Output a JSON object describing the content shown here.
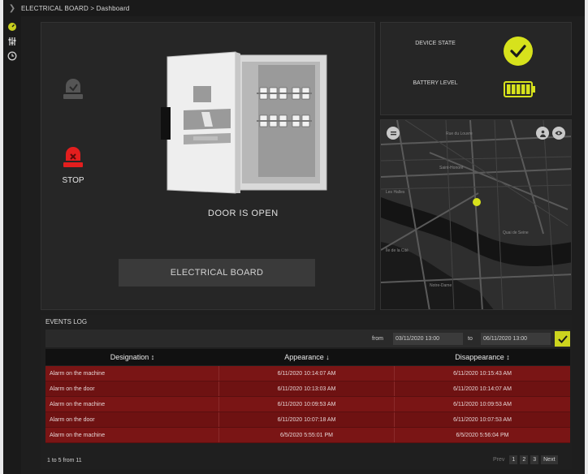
{
  "header": {
    "breadcrumb": "ELECTRICAL BOARD > Dashboard"
  },
  "sidebar": {
    "icons": [
      "gauge-icon",
      "sliders-icon",
      "clock-icon"
    ]
  },
  "main": {
    "stop_label": "STOP",
    "door_status": "DOOR IS OPEN",
    "board_button": "ELECTRICAL BOARD"
  },
  "device": {
    "state_label": "DEVICE STATE",
    "battery_label": "BATTERY LEVEL",
    "battery_level_fraction": 1.0
  },
  "map": {
    "labels": [
      "Rue du Louvre",
      "Saint-Honoré",
      "Les Halles",
      "Île de la Cité",
      "Quai de Seine",
      "Notre-Dame"
    ]
  },
  "events": {
    "title": "EVENTS LOG",
    "from_label": "from",
    "from_value": "03/11/2020 13:00",
    "to_label": "to",
    "to_value": "06/11/2020 13:00",
    "columns": [
      "Designation ↕",
      "Appearance ↓",
      "Disappearance ↕"
    ],
    "rows": [
      [
        "Alarm on the machine",
        "6/11/2020 10:14:07 AM",
        "6/11/2020 10:15:43 AM"
      ],
      [
        "Alarm on the door",
        "6/11/2020 10:13:03 AM",
        "6/11/2020 10:14:07 AM"
      ],
      [
        "Alarm on the machine",
        "6/11/2020 10:09:53 AM",
        "6/11/2020 10:09:53 AM"
      ],
      [
        "Alarm on the door",
        "6/11/2020 10:07:18 AM",
        "6/11/2020 10:07:53 AM"
      ],
      [
        "Alarm on the machine",
        "6/5/2020 5:55:01 PM",
        "6/5/2020 5:56:04 PM"
      ]
    ],
    "summary": "1 to 5 from 11",
    "pager": {
      "prev": "Prev",
      "pages": [
        "1",
        "2",
        "3"
      ],
      "next": "Next"
    }
  },
  "colors": {
    "accent": "#d7e21c",
    "alarm": "#e31e1e",
    "row": "#7a1515"
  }
}
